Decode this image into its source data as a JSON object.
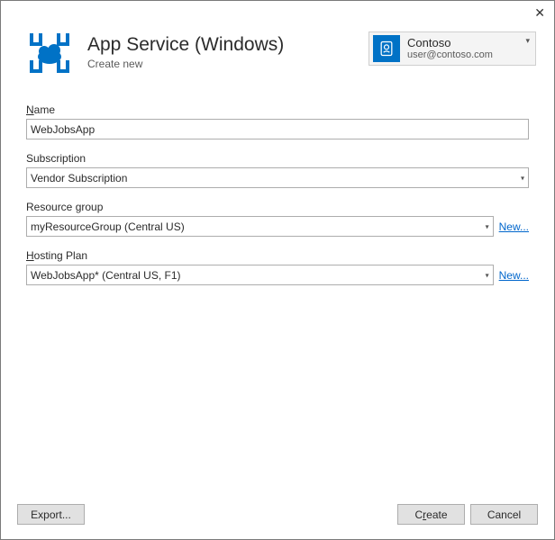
{
  "header": {
    "title": "App Service (Windows)",
    "subtitle": "Create new"
  },
  "account": {
    "name": "Contoso",
    "email": "user@contoso.com"
  },
  "fields": {
    "name": {
      "label_pre": "N",
      "label_post": "ame",
      "value": "WebJobsApp"
    },
    "subscription": {
      "label": "Subscription",
      "value": "Vendor Subscription"
    },
    "resource_group": {
      "label": "Resource group",
      "value": "myResourceGroup (Central US)",
      "new_link": "New..."
    },
    "hosting_plan": {
      "label_pre": "H",
      "label_post": "osting Plan",
      "value": "WebJobsApp* (Central US, F1)",
      "new_link": "New..."
    }
  },
  "buttons": {
    "export": "Export...",
    "create_pre": "C",
    "create_mid": "r",
    "create_post": "eate",
    "cancel": "Cancel"
  }
}
